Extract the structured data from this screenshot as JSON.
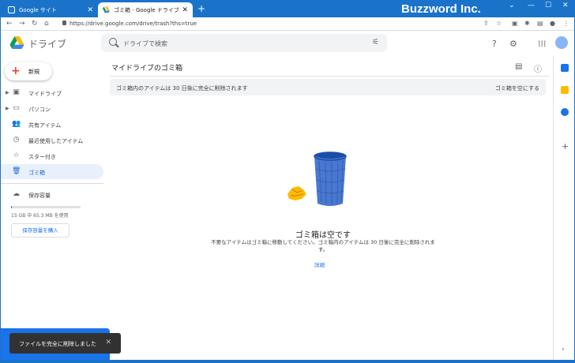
{
  "browser": {
    "tabs": [
      {
        "label": "Google サイト",
        "active": false,
        "favicon_color": "#1a73e8"
      },
      {
        "label": "ゴミ箱 - Google ドライブ",
        "active": true,
        "favicon_color": "#34a853"
      }
    ],
    "new_tab_symbol": "+",
    "watermark": "Buzzword Inc.",
    "window_controls": [
      "⌄",
      "—",
      "☐",
      "✕"
    ],
    "url": "https://drive.google.com/drive/trash?ths=true",
    "nav_icons": [
      "←",
      "→",
      "↻",
      "⌂"
    ],
    "tool_icons": [
      "share-icon",
      "star-icon",
      "extension-icon",
      "puzzle-icon",
      "sidebar-icon",
      "profile-icon",
      "menu-icon"
    ]
  },
  "header": {
    "app_name": "ドライブ",
    "search_placeholder": "ドライブで検索",
    "icons": [
      "help-icon",
      "settings-icon",
      "apps-icon",
      "account-avatar"
    ]
  },
  "sidebar": {
    "new_label": "新規",
    "items": [
      {
        "label": "マイドライブ",
        "icon": "my-drive-icon",
        "expandable": true,
        "active": false
      },
      {
        "label": "パソコン",
        "icon": "computers-icon",
        "expandable": true,
        "active": false
      },
      {
        "label": "共有アイテム",
        "icon": "shared-icon",
        "expandable": false,
        "active": false
      },
      {
        "label": "最近使用したアイテム",
        "icon": "recent-icon",
        "expandable": false,
        "active": false
      },
      {
        "label": "スター付き",
        "icon": "star-icon",
        "expandable": false,
        "active": false
      },
      {
        "label": "ゴミ箱",
        "icon": "trash-icon",
        "expandable": false,
        "active": true
      }
    ],
    "storage_label": "保存容量",
    "storage_used_text": "15 GB 中 65.3 MB を使用",
    "storage_used_fraction": 0.004,
    "buy_storage_label": "保存容量を購入"
  },
  "main": {
    "title": "マイドライブのゴミ箱",
    "view_icons": [
      "list-view-icon",
      "info-icon"
    ],
    "banner_text": "ゴミ箱内のアイテムは 30 日後に完全に削除されます",
    "banner_action": "ゴミ箱を空にする",
    "empty_title": "ゴミ箱は空です",
    "empty_description": "不要なアイテムはゴミ箱に移動してください。ゴミ箱内のアイテムは 30 日後に完全に削除されます。",
    "details_link": "詳細"
  },
  "side_panel": {
    "apps": [
      {
        "name": "calendar-icon",
        "color": "#1a73e8"
      },
      {
        "name": "keep-icon",
        "color": "#fbbc04"
      },
      {
        "name": "tasks-icon",
        "color": "#1a73e8"
      }
    ],
    "add_symbol": "+",
    "expand_symbol": "›"
  },
  "toast": {
    "message": "ファイルを完全に削除しました",
    "close_symbol": "✕"
  }
}
